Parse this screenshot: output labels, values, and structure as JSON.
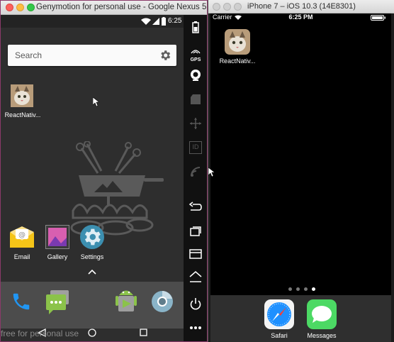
{
  "genymotion": {
    "window_title": "Genymotion for personal use - Google Nexus 5",
    "status_time": "6:25",
    "search_placeholder": "Search",
    "home_apps": [
      {
        "label": "ReactNativ..."
      }
    ],
    "shortcuts": [
      {
        "label": "Email",
        "icon": "email-icon"
      },
      {
        "label": "Gallery",
        "icon": "gallery-icon"
      },
      {
        "label": "Settings",
        "icon": "settings-icon"
      }
    ],
    "dock": [
      {
        "icon": "phone-icon"
      },
      {
        "icon": "messaging-icon"
      },
      {
        "icon": "play-store-icon"
      },
      {
        "icon": "chrome-icon"
      }
    ],
    "watermark": "free for personal use",
    "toolbar_icons": [
      "battery-icon",
      "gps-icon",
      "camera-icon",
      "capture-icon",
      "move-icon",
      "id-icon",
      "signal-icon",
      "back-icon",
      "recents-icon",
      "menu-icon",
      "home-icon",
      "power-icon",
      "more-icon"
    ],
    "toolbar_gps_label": "GPS",
    "toolbar_id_label": "ID"
  },
  "ios": {
    "window_title": "iPhone 7 – iOS 10.3 (14E8301)",
    "carrier": "Carrier",
    "time": "6:25 PM",
    "home_apps": [
      {
        "label": "ReactNativ..."
      }
    ],
    "dock": [
      {
        "label": "Safari",
        "icon": "safari-icon"
      },
      {
        "label": "Messages",
        "icon": "messages-icon"
      }
    ]
  },
  "colors": {
    "android_bg": "#2e2e2e",
    "email_yellow": "#f5c518",
    "messages_green": "#4cd964",
    "safari_blue": "#1e90ff",
    "phone_blue": "#2196f3"
  }
}
